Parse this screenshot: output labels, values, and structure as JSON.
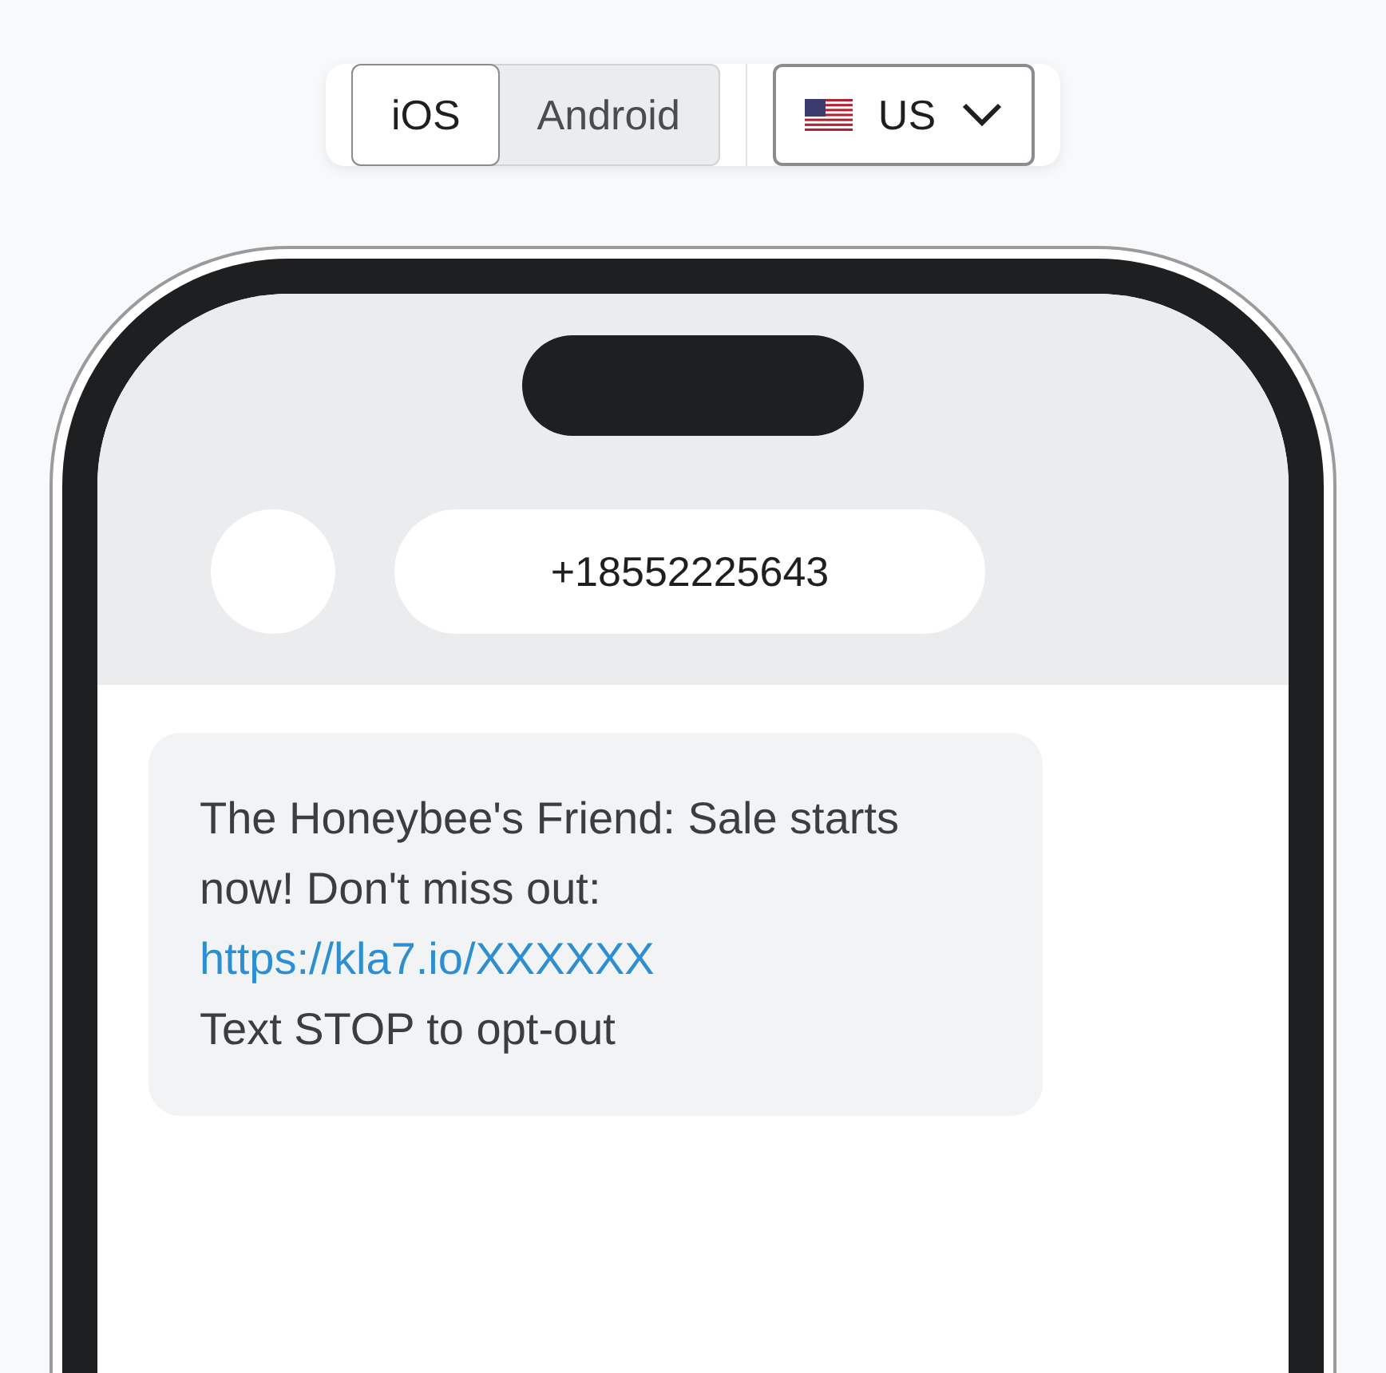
{
  "platform_tabs": [
    {
      "label": "iOS",
      "selected": true
    },
    {
      "label": "Android",
      "selected": false
    }
  ],
  "country_select": {
    "value": "US"
  },
  "contact": {
    "phone": "+18552225643"
  },
  "message": {
    "text": "The Honeybee's Friend: Sale starts now! Don't miss out:",
    "link": "https://kla7.io/XXXXXX",
    "footer": "Text STOP to opt-out"
  }
}
